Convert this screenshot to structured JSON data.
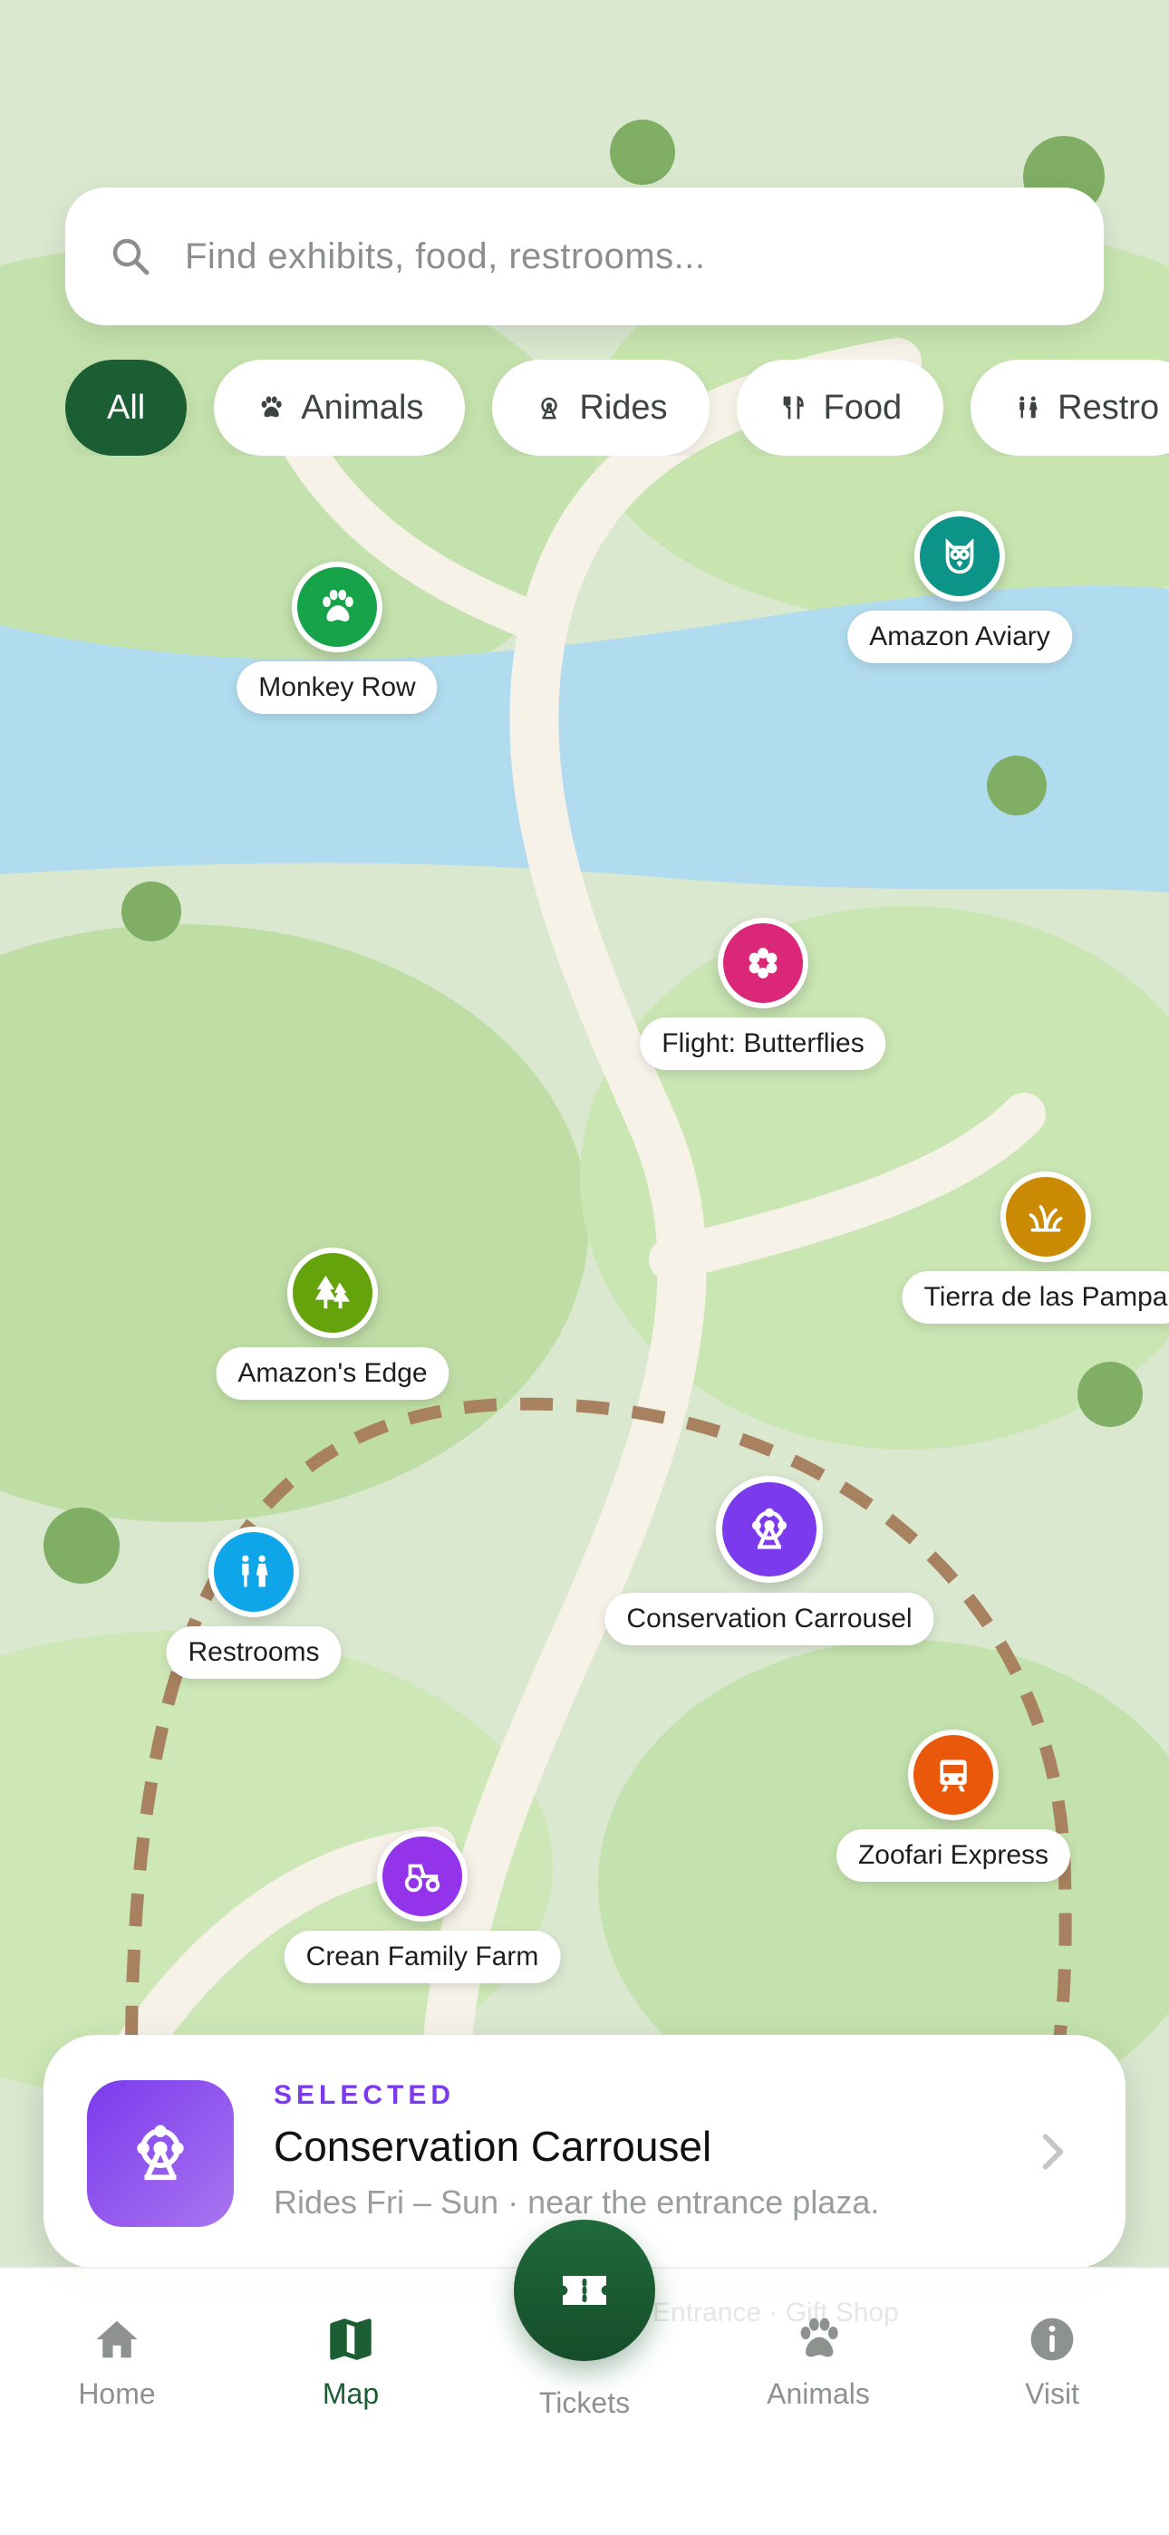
{
  "search": {
    "placeholder": "Find exhibits, food, restrooms..."
  },
  "filters": [
    {
      "label": "All",
      "active": true
    },
    {
      "label": "Animals",
      "icon": "paw-icon"
    },
    {
      "label": "Rides",
      "icon": "ferris-wheel-icon"
    },
    {
      "label": "Food",
      "icon": "fork-knife-icon"
    },
    {
      "label": "Restro",
      "icon": "restroom-icon"
    }
  ],
  "pins": [
    {
      "label": "Monkey Row",
      "icon": "paw-icon",
      "color": "#16a34a"
    },
    {
      "label": "Amazon Aviary",
      "icon": "owl-icon",
      "color": "#0d9488"
    },
    {
      "label": "Flight: Butterflies",
      "icon": "flower-icon",
      "color": "#db2777"
    },
    {
      "label": "Tierra de las Pampa",
      "icon": "grass-icon",
      "color": "#ca8a04"
    },
    {
      "label": "Amazon's Edge",
      "icon": "trees-icon",
      "color": "#65a30d"
    },
    {
      "label": "Conservation Carrousel",
      "icon": "ferris-wheel-icon",
      "color": "#7c3aed"
    },
    {
      "label": "Restrooms",
      "icon": "restroom-icon",
      "color": "#0ea5e9"
    },
    {
      "label": "Zoofari Express",
      "icon": "train-icon",
      "color": "#ea580c"
    },
    {
      "label": "Crean Family Farm",
      "icon": "tractor-icon",
      "color": "#9333ea"
    }
  ],
  "selected": {
    "kicker": "SELECTED",
    "title": "Conservation Carrousel",
    "subtitle": "Rides Fri – Sun · near the entrance plaza.",
    "icon": "ferris-wheel-icon"
  },
  "ghost_label": "Entrance · Gift Shop",
  "nav": [
    {
      "label": "Home",
      "icon": "home-icon"
    },
    {
      "label": "Map",
      "icon": "map-icon",
      "active": true
    },
    {
      "label": "Tickets",
      "icon": "ticket-icon",
      "primary": true
    },
    {
      "label": "Animals",
      "icon": "paw-icon"
    },
    {
      "label": "Visit",
      "icon": "info-icon"
    }
  ],
  "colors": {
    "brand": "#1b5e33",
    "accent": "#7c3aed",
    "water": "#b3dcef",
    "path": "#f5f1e6"
  }
}
